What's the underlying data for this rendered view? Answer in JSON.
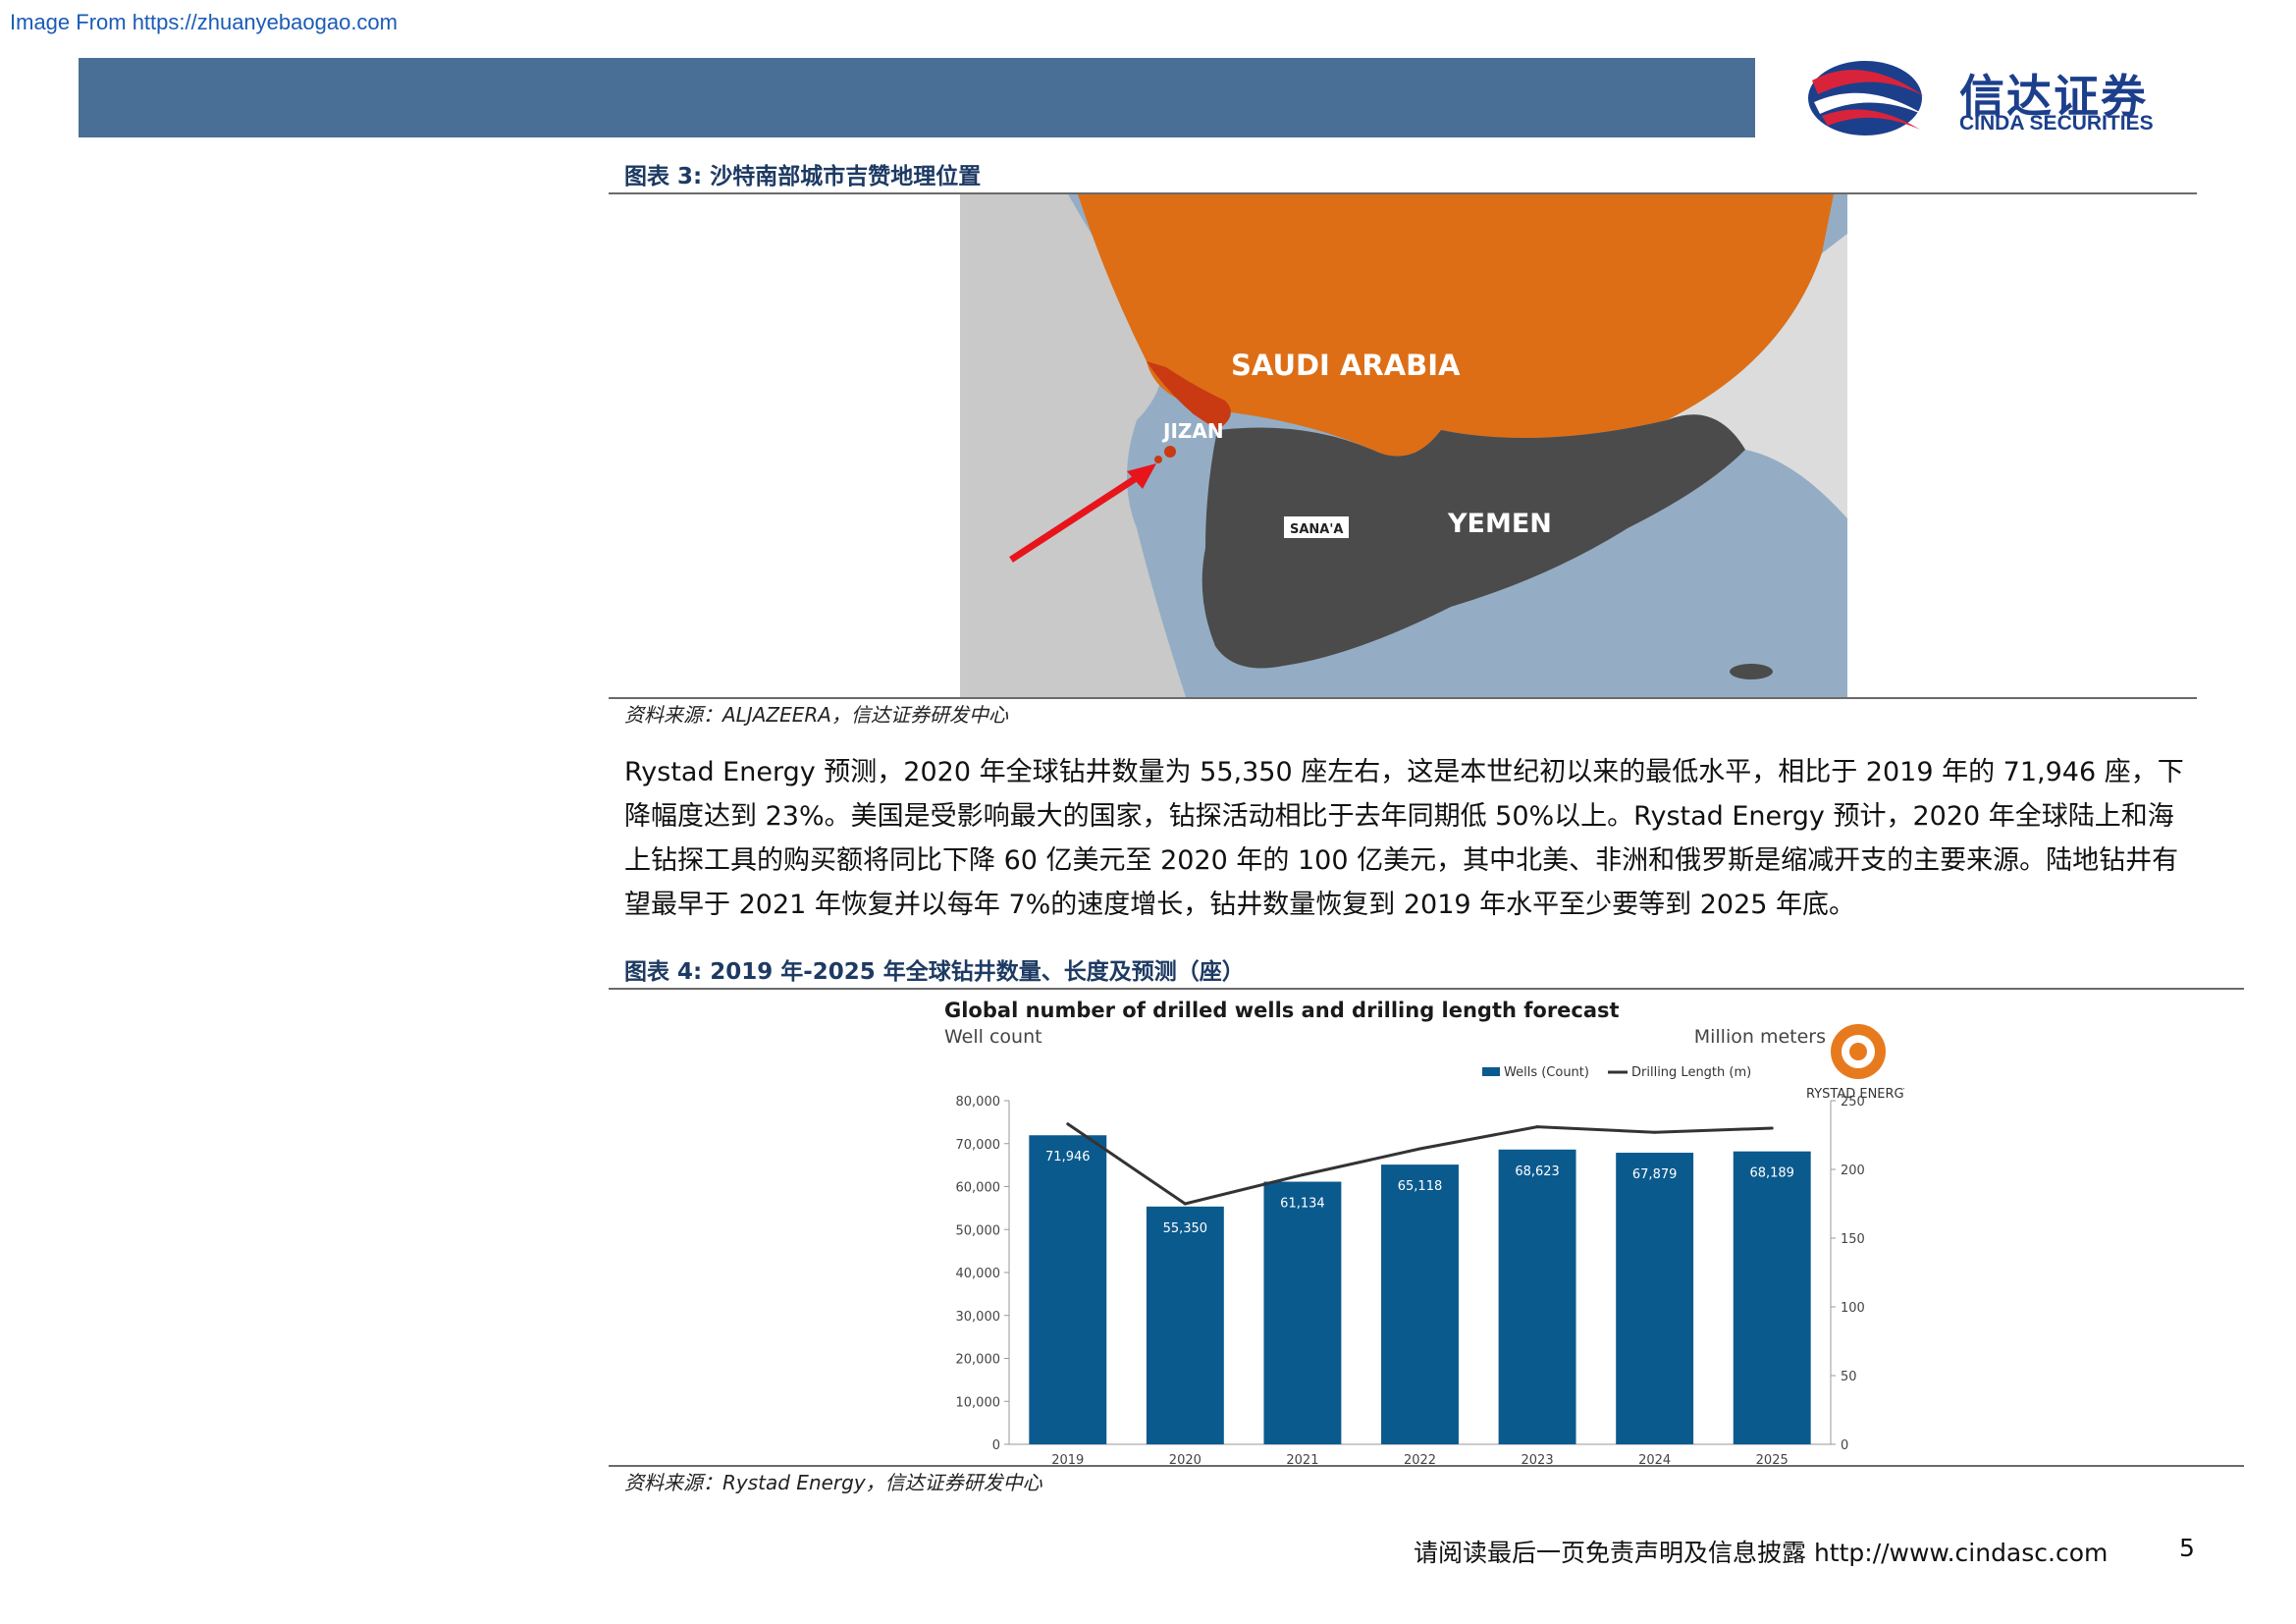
{
  "watermark": "Image From https://zhuanyebaogao.com",
  "logo": {
    "cn": "信达证券",
    "en": "CINDA SECURITIES"
  },
  "figure3": {
    "title": "图表 3:  沙特南部城市吉赞地理位置",
    "map_labels": {
      "saudi": "SAUDI ARABIA",
      "jizan": "JIZAN",
      "yemen": "YEMEN",
      "sanaa": "SANA'A"
    },
    "source": "资料来源：ALJAZEERA，信达证券研发中心"
  },
  "body": {
    "paragraph": "Rystad Energy 预测，2020 年全球钻井数量为 55,350 座左右，这是本世纪初以来的最低水平，相比于 2019 年的 71,946 座，下降幅度达到 23%。美国是受影响最大的国家，钻探活动相比于去年同期低 50%以上。Rystad Energy 预计，2020 年全球陆上和海上钻探工具的购买额将同比下降 60 亿美元至 2020 年的 100 亿美元，其中北美、非洲和俄罗斯是缩减开支的主要来源。陆地钻井有望最早于 2021 年恢复并以每年 7%的速度增长，钻井数量恢复到 2019 年水平至少要等到 2025 年底。"
  },
  "figure4": {
    "title": "图表 4:  2019 年-2025 年全球钻井数量、长度及预测（座）",
    "source": "资料来源：Rystad Energy，信达证券研发中心"
  },
  "chart_data": {
    "type": "bar",
    "title": "Global number of drilled wells and drilling length forecast",
    "ylabel": "Well count",
    "y2label": "Million meters",
    "brand": "RYSTAD ENERGY",
    "categories": [
      "2019",
      "2020",
      "2021",
      "2022",
      "2023",
      "2024",
      "2025"
    ],
    "ylim": [
      0,
      80000
    ],
    "y2lim": [
      0,
      250
    ],
    "yticks": [
      "0",
      "10,000",
      "20,000",
      "30,000",
      "40,000",
      "50,000",
      "60,000",
      "70,000",
      "80,000"
    ],
    "y2ticks": [
      "0",
      "50",
      "100",
      "150",
      "200",
      "250"
    ],
    "series": [
      {
        "name": "Wells (Count)",
        "type": "bar",
        "color": "#0b5a8e",
        "values": [
          71946,
          55350,
          61134,
          65118,
          68623,
          67879,
          68189
        ],
        "labels": [
          "71,946",
          "55,350",
          "61,134",
          "65,118",
          "68,623",
          "67,879",
          "68,189"
        ]
      },
      {
        "name": "Drilling Length (m)",
        "type": "line",
        "axis": "right",
        "color": "#333333",
        "values": [
          233,
          175,
          196,
          215,
          231,
          227,
          230
        ]
      }
    ],
    "legend": "top-right",
    "grid": false
  },
  "footer": {
    "note": "请阅读最后一页免责声明及信息披露 http://www.cindasc.com",
    "page": "5"
  }
}
